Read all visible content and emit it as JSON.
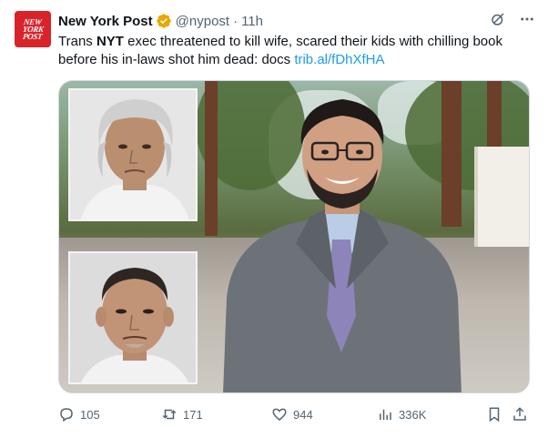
{
  "tweet": {
    "author_name": "New York Post",
    "handle": "@nypost",
    "separator": "·",
    "time": "11h",
    "avatar_text": [
      "NEW",
      "YORK",
      "POST"
    ],
    "text_part1": "Trans ",
    "text_bold": "NYT",
    "text_part2": " exec threatened to kill wife, scared their kids with chilling book before his in-laws shot him dead: docs ",
    "link": "trib.al/fDhXfHA",
    "verified_color": "#e8a800"
  },
  "actions": {
    "replies": "105",
    "retweets": "171",
    "likes": "944",
    "views": "336K"
  },
  "icons": {
    "grok": "grok-icon",
    "more": "more-icon",
    "reply": "reply-icon",
    "retweet": "retweet-icon",
    "like": "heart-icon",
    "views": "views-icon",
    "bookmark": "bookmark-icon",
    "share": "share-icon"
  },
  "colors": {
    "link": "#1d9bf0",
    "muted": "#536471",
    "brand": "#d8232a"
  }
}
